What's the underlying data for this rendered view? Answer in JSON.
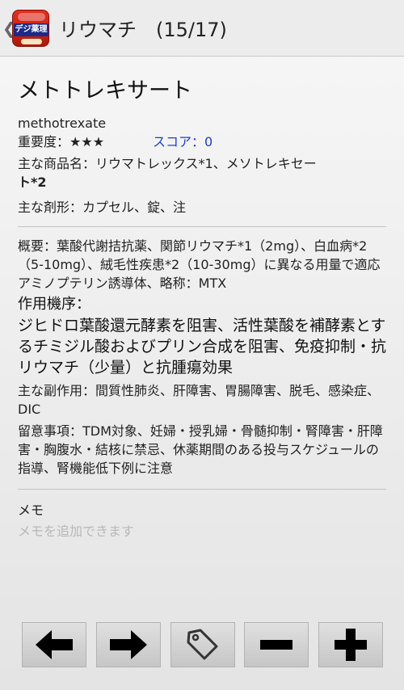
{
  "header": {
    "title": "リウマチ　(15/17)",
    "icon_text": "デジ薬理",
    "up_glyph": "❮"
  },
  "drug": {
    "name": "メトトレキサート",
    "latin": "methotrexate",
    "importance_label": "重要度：",
    "importance_value": "★★★",
    "score": "スコア：0",
    "brands_prefix": "主な商品名：リウマトレックス*1、メソトレキセー",
    "brands_suffix": "ト*2",
    "forms": "主な剤形：カプセル、錠、注"
  },
  "detail": {
    "overview": "概要：葉酸代謝拮抗薬、関節リウマチ*1（2mg）、白血病*2（5-10mg）、絨毛性疾患*2（10-30mg）に異なる用量で適応",
    "alias": "アミノプテリン誘導体、略称：MTX",
    "mechanism_title": "作用機序：",
    "mechanism": "ジヒドロ葉酸還元酵素を阻害、活性葉酸を補酵素とするチミジル酸およびプリン合成を阻害、免疫抑制・抗リウマチ（少量）と抗腫瘍効果",
    "side_effects": "主な副作用：間質性肺炎、肝障害、胃腸障害、脱毛、感染症、DIC",
    "notes": "留意事項：TDM対象、妊婦・授乳婦・骨髄抑制・腎障害・肝障害・胸腹水・結核に禁忌、休薬期間のある投与スケジュールの指導、腎機能低下例に注意"
  },
  "memo": {
    "label": "メモ",
    "placeholder": "メモを追加できます"
  },
  "toolbar": {
    "icons": [
      "arrow-left-icon",
      "arrow-right-icon",
      "tag-icon",
      "minus-icon",
      "plus-icon"
    ]
  }
}
